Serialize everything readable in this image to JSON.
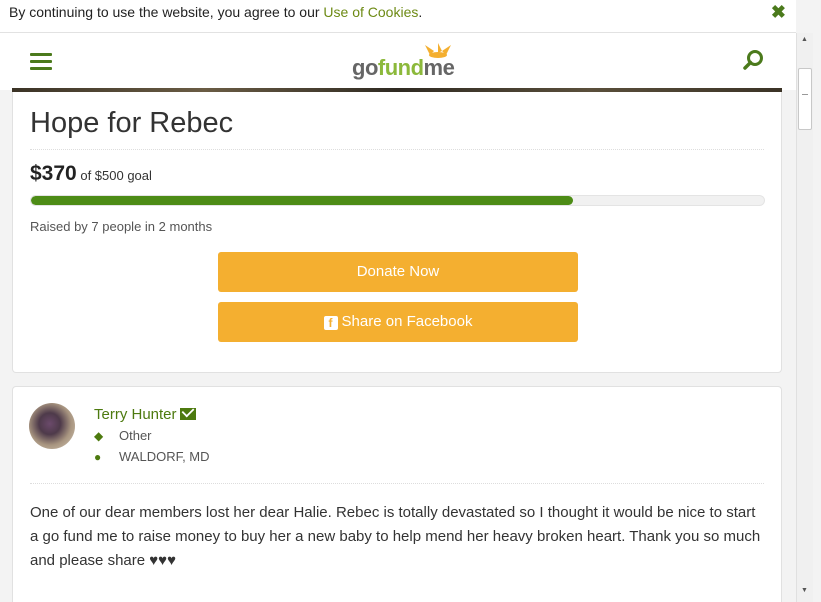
{
  "cookie_bar": {
    "text": "By continuing to use the website, you agree to our ",
    "link": "Use of Cookies",
    "suffix": ".",
    "close": "✖"
  },
  "header": {
    "logo_go": "go",
    "logo_fund": "fund",
    "logo_me": "me"
  },
  "campaign": {
    "title": "Hope for Rebec",
    "raised_amount": "$370",
    "goal_text": "of $500 goal",
    "progress_fraction": 0.74,
    "raised_by": "Raised by 7 people in 2 months",
    "donate_label": "Donate Now",
    "share_label": "Share on Facebook"
  },
  "organizer": {
    "name": "Terry Hunter",
    "category": "Other",
    "location": "WALDORF, MD",
    "story": "One of our dear members lost her dear Halie. Rebec is totally devastated so I thought it would be nice to start a go fund me to raise money to buy her a new baby to help mend her heavy broken heart. Thank you so much and please share ♥♥♥"
  },
  "colors": {
    "accent_green": "#4d8c16",
    "button_orange": "#f4af30"
  }
}
